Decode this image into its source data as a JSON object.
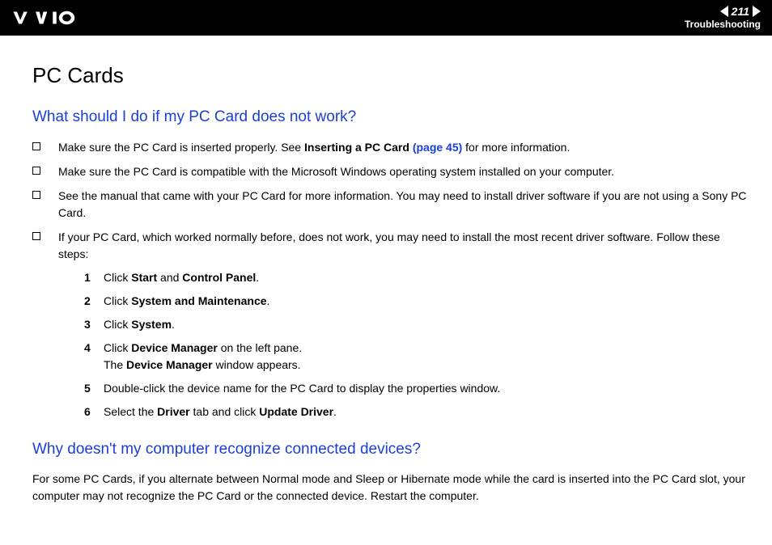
{
  "header": {
    "page_number": "211",
    "section": "Troubleshooting"
  },
  "title": "PC Cards",
  "q1": {
    "heading": "What should I do if my PC Card does not work?",
    "bullets": {
      "b1_pre": "Make sure the PC Card is inserted properly. See ",
      "b1_bold": "Inserting a PC Card ",
      "b1_link": "(page 45)",
      "b1_post": " for more information.",
      "b2": "Make sure the PC Card is compatible with the Microsoft Windows operating system installed on your computer.",
      "b3": "See the manual that came with your PC Card for more information. You may need to install driver software if you are not using a Sony PC Card.",
      "b4": "If your PC Card, which worked normally before, does not work, you may need to install the most recent driver software. Follow these steps:"
    },
    "steps": {
      "s1_a": "Click ",
      "s1_b": "Start",
      "s1_c": " and ",
      "s1_d": "Control Panel",
      "s1_e": ".",
      "s2_a": "Click ",
      "s2_b": "System and Maintenance",
      "s2_c": ".",
      "s3_a": "Click ",
      "s3_b": "System",
      "s3_c": ".",
      "s4_a": "Click ",
      "s4_b": "Device Manager",
      "s4_c": " on the left pane.",
      "s4_d": "The ",
      "s4_e": "Device Manager",
      "s4_f": " window appears.",
      "s5": "Double-click the device name for the PC Card to display the properties window.",
      "s6_a": "Select the ",
      "s6_b": "Driver",
      "s6_c": " tab and click ",
      "s6_d": "Update Driver",
      "s6_e": "."
    }
  },
  "q2": {
    "heading": "Why doesn't my computer recognize connected devices?",
    "body": "For some PC Cards, if you alternate between Normal mode and Sleep or Hibernate mode while the card is inserted into the PC Card slot, your computer may not recognize the PC Card or the connected device. Restart the computer."
  }
}
